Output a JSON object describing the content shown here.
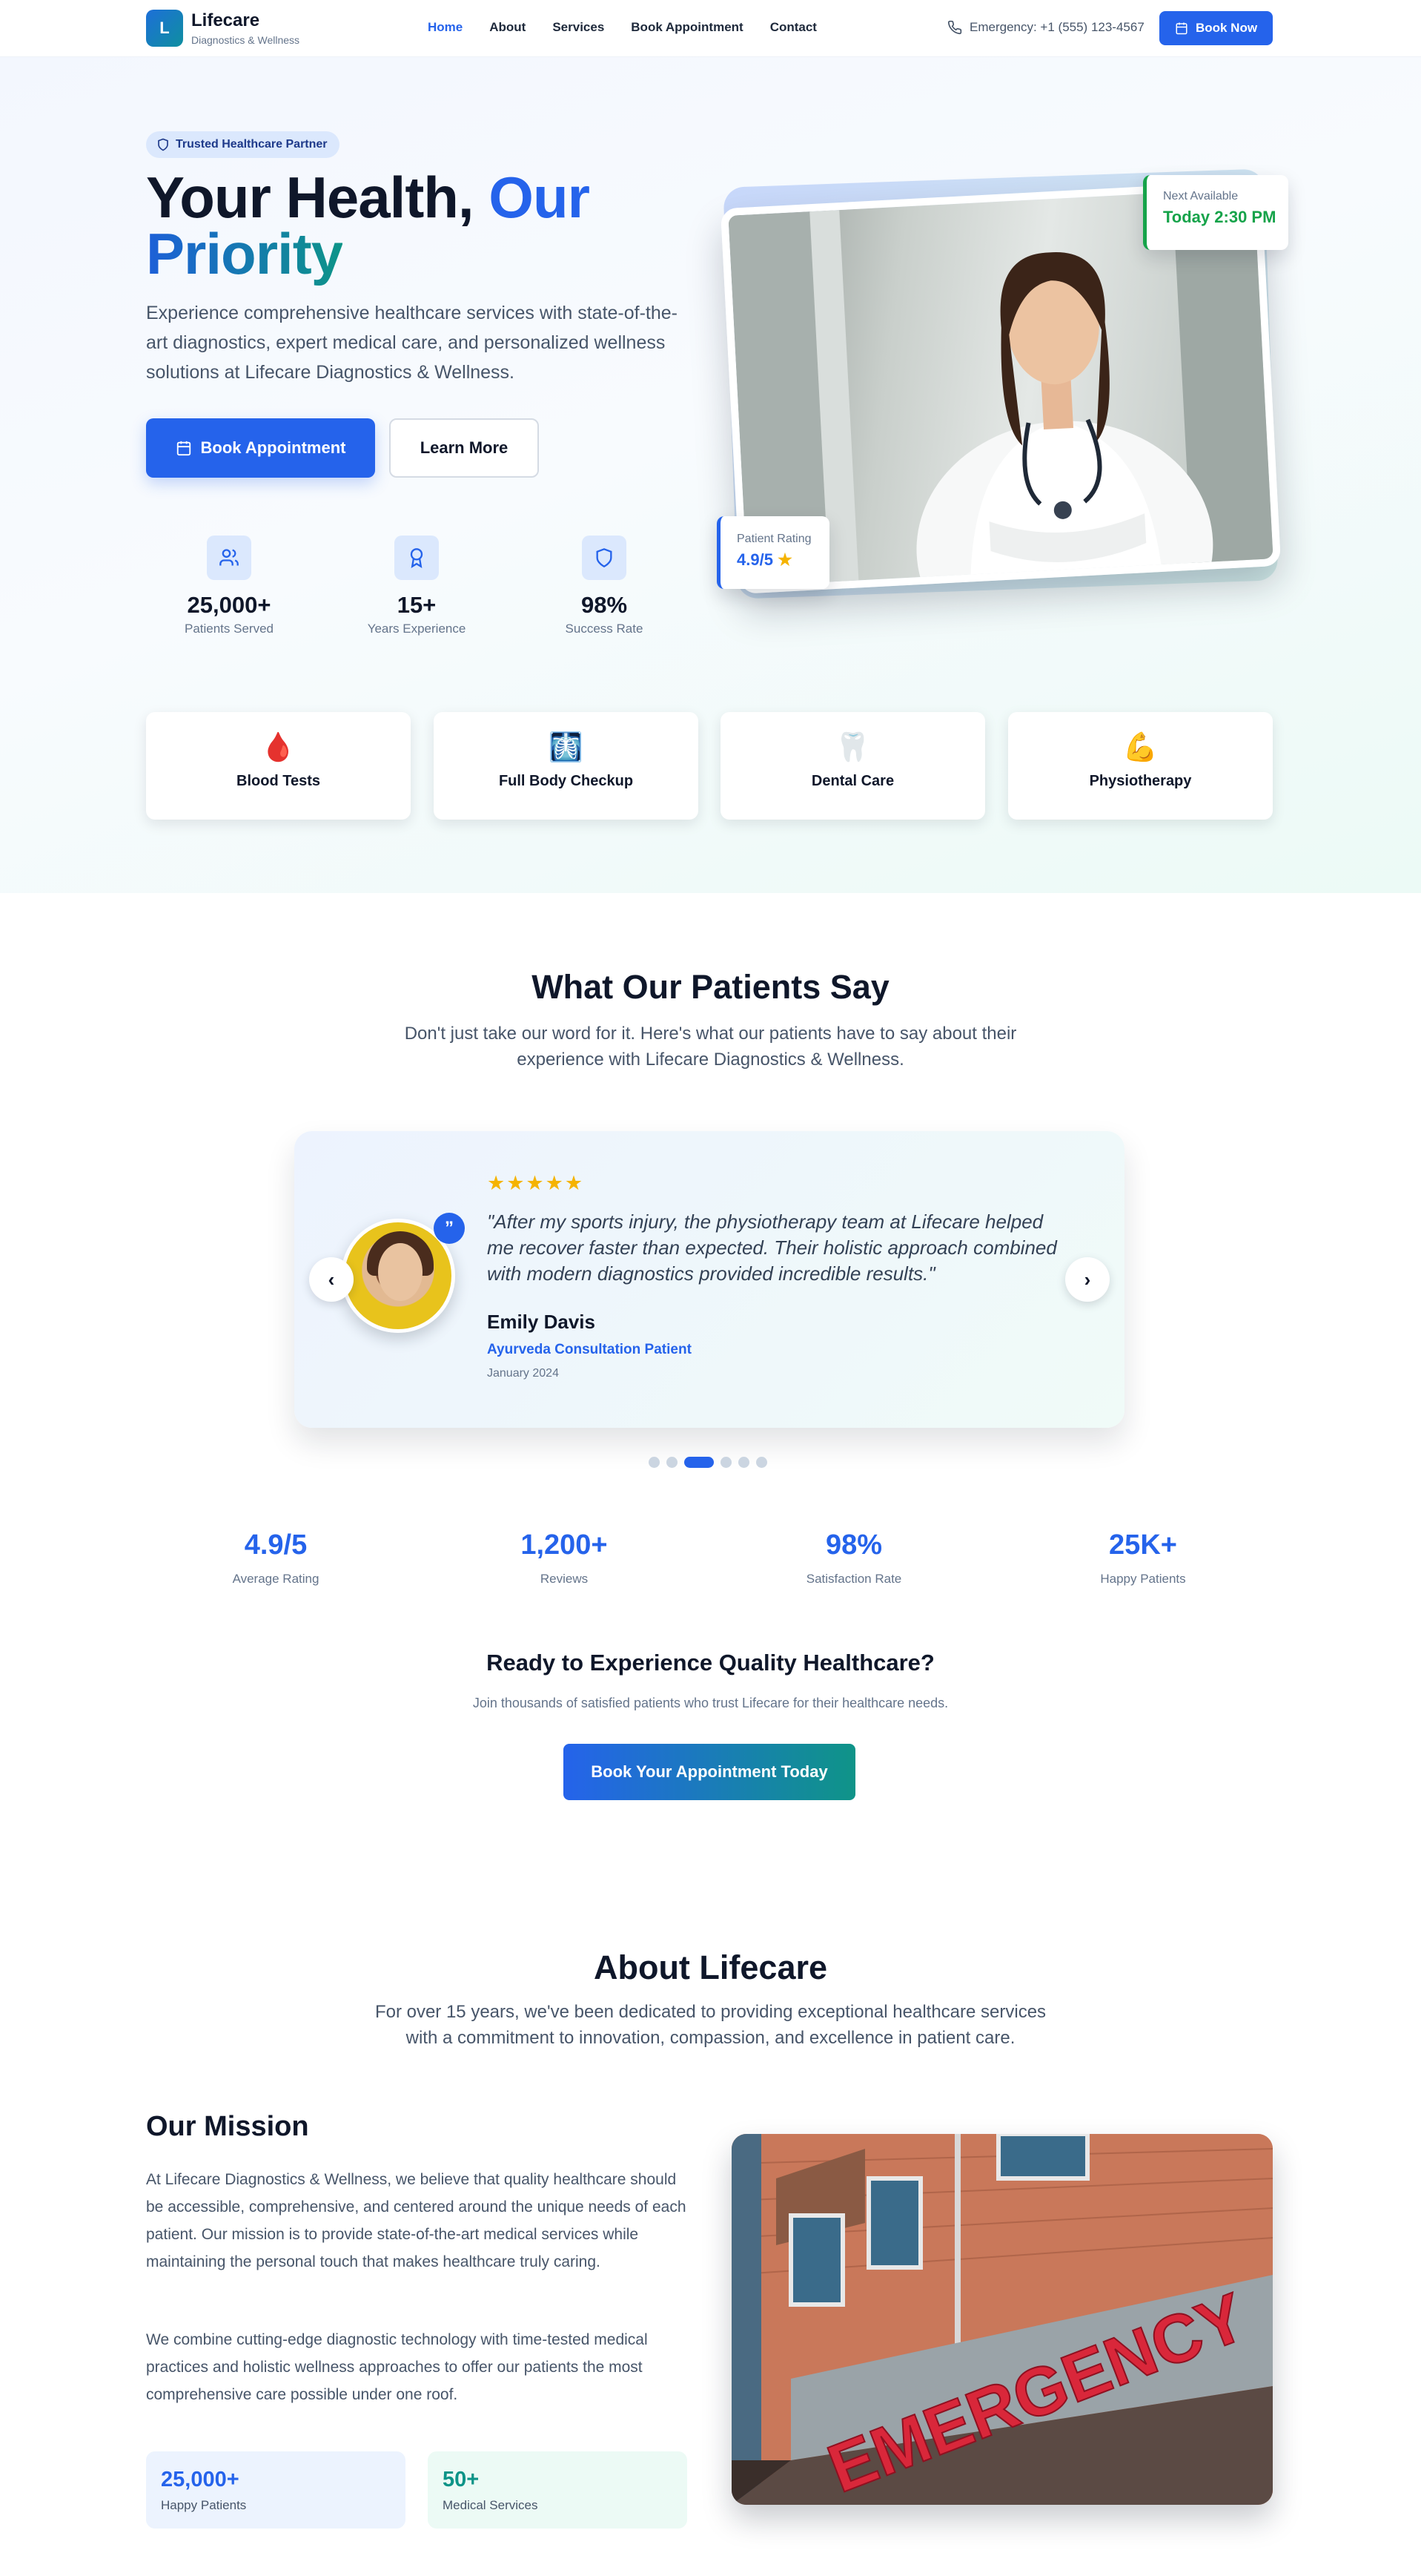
{
  "nav": {
    "logo_letter": "L",
    "brand": "Lifecare",
    "brand_sub": "Diagnostics & Wellness",
    "links": [
      "Home",
      "About",
      "Services",
      "Book Appointment",
      "Contact"
    ],
    "emergency": "Emergency: +1 (555) 123-4567",
    "book_now": "Book Now"
  },
  "hero": {
    "badge": "Trusted Healthcare Partner",
    "title_part1": "Your Health,",
    "title_part2": "Our",
    "title_part3": "Priority",
    "description": "Experience comprehensive healthcare services with state-of-the-art diagnostics, expert medical care, and personalized wellness solutions at Lifecare Diagnostics & Wellness.",
    "btn_book": "Book Appointment",
    "btn_learn": "Learn More",
    "stats": [
      {
        "value": "25,000+",
        "label": "Patients Served",
        "icon": "users-icon"
      },
      {
        "value": "15+",
        "label": "Years Experience",
        "icon": "award-icon"
      },
      {
        "value": "98%",
        "label": "Success Rate",
        "icon": "shield-icon"
      }
    ],
    "next_available_label": "Next Available",
    "next_available_value": "Today 2:30 PM",
    "rating_label": "Patient Rating",
    "rating_value": "4.9/5"
  },
  "services": [
    {
      "name": "Blood Tests",
      "icon": "🩸"
    },
    {
      "name": "Full Body Checkup",
      "icon": "🩻"
    },
    {
      "name": "Dental Care",
      "icon": "🦷"
    },
    {
      "name": "Physiotherapy",
      "icon": "💪"
    }
  ],
  "testimonials": {
    "title": "What Our Patients Say",
    "subtitle": "Don't just take our word for it. Here's what our patients have to say about their experience with Lifecare Diagnostics & Wellness.",
    "stars": "★★★★★",
    "quote": "\"After my sports injury, the physiotherapy team at Lifecare helped me recover faster than expected. Their holistic approach combined with modern diagnostics provided incredible results.\"",
    "name": "Emily Davis",
    "role": "Ayurveda Consultation Patient",
    "date": "January 2024",
    "slide_count": 6,
    "active_slide": 2
  },
  "metrics": [
    {
      "value": "4.9/5",
      "label": "Average Rating"
    },
    {
      "value": "1,200+",
      "label": "Reviews"
    },
    {
      "value": "98%",
      "label": "Satisfaction Rate"
    },
    {
      "value": "25K+",
      "label": "Happy Patients"
    }
  ],
  "cta": {
    "title": "Ready to Experience Quality Healthcare?",
    "subtitle": "Join thousands of satisfied patients who trust Lifecare for their healthcare needs.",
    "button": "Book Your Appointment Today"
  },
  "about": {
    "title": "About Lifecare",
    "subtitle": "For over 15 years, we've been dedicated to providing exceptional healthcare services with a commitment to innovation, compassion, and excellence in patient care.",
    "mission_title": "Our Mission",
    "mission_p1": "At Lifecare Diagnostics & Wellness, we believe that quality healthcare should be accessible, comprehensive, and centered around the unique needs of each patient. Our mission is to provide state-of-the-art medical services while maintaining the personal touch that makes healthcare truly caring.",
    "mission_p2": "We combine cutting-edge diagnostic technology with time-tested medical practices and holistic wellness approaches to offer our patients the most comprehensive care possible under one roof.",
    "stat1_value": "25,000+",
    "stat1_label": "Happy Patients",
    "stat2_value": "50+",
    "stat2_label": "Medical Services",
    "sign_text": "EMERGENCY"
  },
  "colors": {
    "primary": "#2563eb",
    "teal": "#0d9488",
    "green": "#16a34a",
    "star": "#f5b301"
  }
}
